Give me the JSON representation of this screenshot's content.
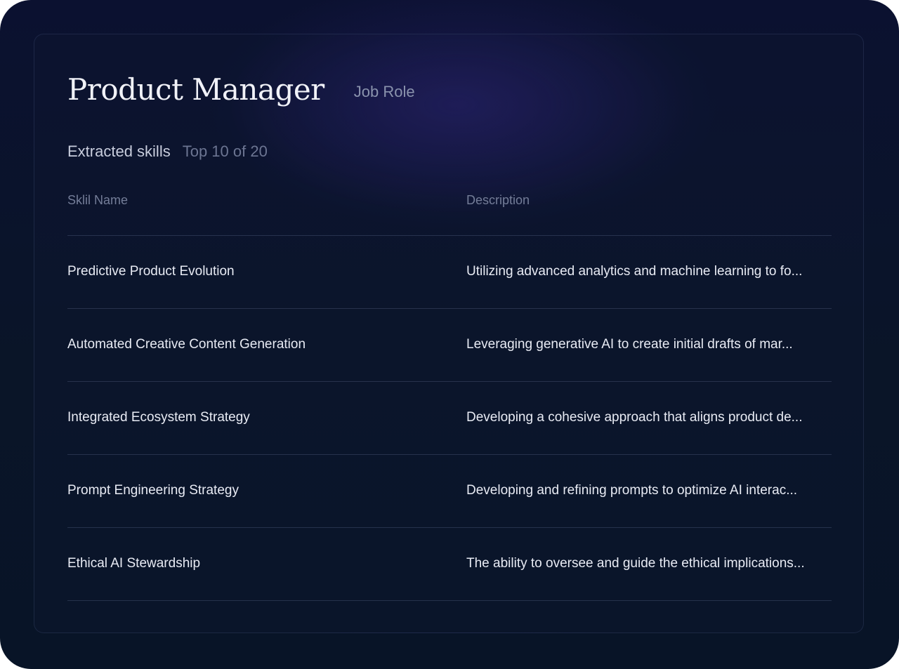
{
  "header": {
    "title": "Product Manager",
    "subtitle": "Job Role"
  },
  "skills_section": {
    "title": "Extracted skills",
    "count_label": "Top 10 of 20"
  },
  "table": {
    "columns": [
      "Sklil Name",
      "Description"
    ],
    "rows": [
      {
        "name": "Predictive Product Evolution",
        "description": "Utilizing advanced analytics and machine learning to fo..."
      },
      {
        "name": "Automated Creative Content Generation",
        "description": "Leveraging generative AI to create initial drafts of mar..."
      },
      {
        "name": "Integrated Ecosystem Strategy",
        "description": "Developing a cohesive approach that aligns product de..."
      },
      {
        "name": "Prompt Engineering Strategy",
        "description": "Developing and refining prompts to optimize AI interac..."
      },
      {
        "name": "Ethical AI Stewardship",
        "description": "The ability to oversee and guide the ethical implications..."
      }
    ]
  },
  "colors": {
    "background": "#0a1528",
    "accent_glow": "#28206e",
    "text_primary": "#e8ebf4",
    "text_muted": "#747d98"
  }
}
